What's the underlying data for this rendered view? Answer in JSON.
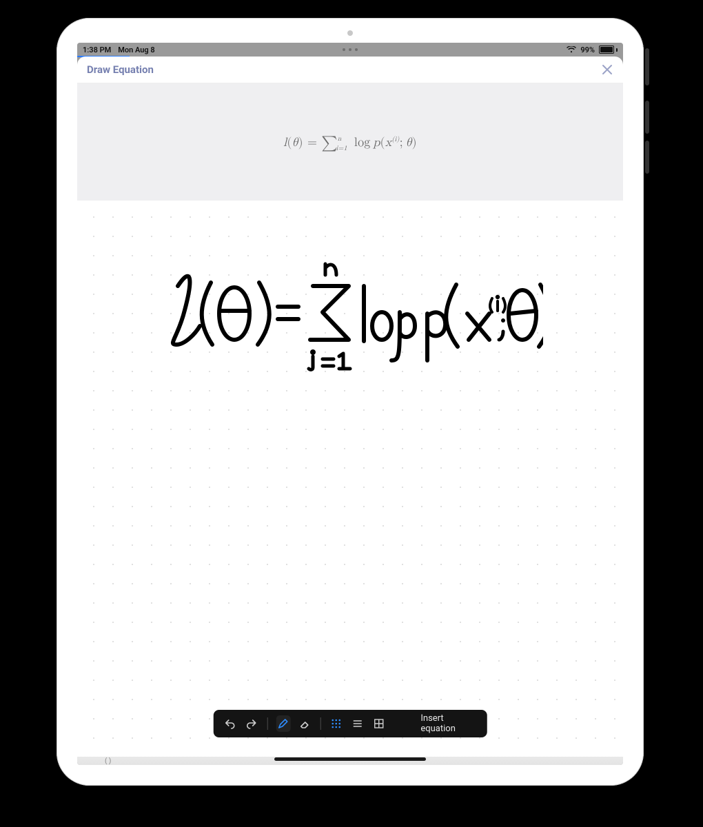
{
  "status_bar": {
    "time": "1:38 PM",
    "date": "Mon Aug 8",
    "battery_percent": "99%"
  },
  "modal": {
    "title": "Draw Equation"
  },
  "preview": {
    "latex_display": "l(θ) = ∑_{i=1}^{n} log p(x^{(i)}; θ)"
  },
  "handwriting": {
    "expression_description": "l(θ) = Σ_{i=1}^{n} log p(x^{(i)}; θ)"
  },
  "toolbar": {
    "undo_tooltip": "Undo",
    "redo_tooltip": "Redo",
    "pen_tooltip": "Pen",
    "eraser_tooltip": "Eraser",
    "grid_dots_tooltip": "Dot grid",
    "grid_lines_tooltip": "Line grid",
    "grid_squares_tooltip": "Square grid",
    "insert_label": "Insert equation"
  },
  "icons": {
    "close": "close-icon",
    "wifi": "wifi-icon",
    "battery": "battery-icon",
    "undo": "undo-icon",
    "redo": "redo-icon",
    "pen": "pen-icon",
    "eraser": "eraser-icon",
    "grid_dots": "grid-dots-icon",
    "grid_lines": "grid-lines-icon",
    "grid_squares": "grid-squares-icon"
  }
}
